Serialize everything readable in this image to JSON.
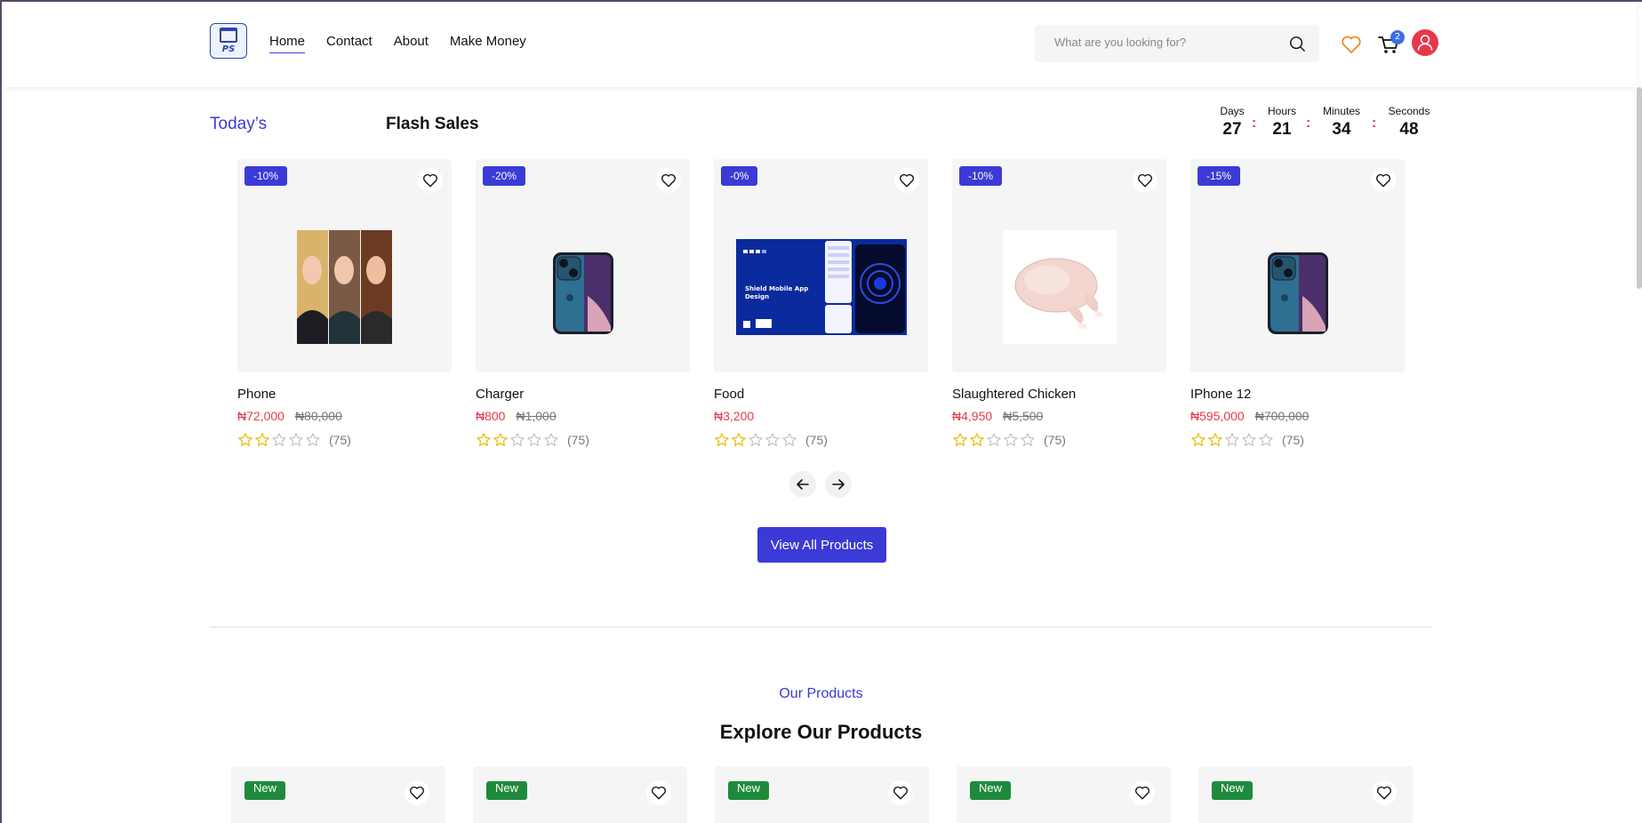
{
  "header": {
    "logo_text": "PS",
    "nav": [
      "Home",
      "Contact",
      "About",
      "Make Money"
    ],
    "active_nav": "Home",
    "search_placeholder": "What are you looking for?",
    "cart_count": "2",
    "colors": {
      "accent": "#3a3ad6",
      "wishlist_icon": "#f08a24",
      "avatar": "#e5394a",
      "badge": "#3d6ee8"
    },
    "icons": [
      "search-icon",
      "heart-icon",
      "cart-icon",
      "user-icon"
    ]
  },
  "flash": {
    "eyebrow": "Today’s",
    "title": "Flash Sales",
    "countdown": [
      {
        "label": "Days",
        "value": "27"
      },
      {
        "label": "Hours",
        "value": "21"
      },
      {
        "label": "Minutes",
        "value": "34"
      },
      {
        "label": "Seconds",
        "value": "48"
      }
    ],
    "separator": ":",
    "products": [
      {
        "name": "Phone",
        "discount": "-10%",
        "price": "₦72,000",
        "old_price": "₦80,000",
        "stars": 2,
        "max_stars": 5,
        "reviews": "(75)",
        "image": "portrait-photo"
      },
      {
        "name": "Charger",
        "discount": "-20%",
        "price": "₦800",
        "old_price": "₦1,000",
        "stars": 2,
        "max_stars": 5,
        "reviews": "(75)",
        "image": "iphone-photo"
      },
      {
        "name": "Food",
        "discount": "-0%",
        "price": "₦3,200",
        "old_price": "",
        "stars": 2,
        "max_stars": 5,
        "reviews": "(75)",
        "image": "app-design-banner"
      },
      {
        "name": "Slaughtered Chicken",
        "discount": "-10%",
        "price": "₦4,950",
        "old_price": "₦5,500",
        "stars": 2,
        "max_stars": 5,
        "reviews": "(75)",
        "image": "chicken-photo"
      },
      {
        "name": "IPhone 12",
        "discount": "-15%",
        "price": "₦595,000",
        "old_price": "₦700,000",
        "stars": 2,
        "max_stars": 5,
        "reviews": "(75)",
        "image": "iphone-photo"
      }
    ],
    "banner_text": "Shield Mobile App Design",
    "view_all_label": "View All Products"
  },
  "explore": {
    "eyebrow": "Our Products",
    "title": "Explore Our Products",
    "badges": [
      "New",
      "New",
      "New",
      "New",
      "New"
    ]
  }
}
